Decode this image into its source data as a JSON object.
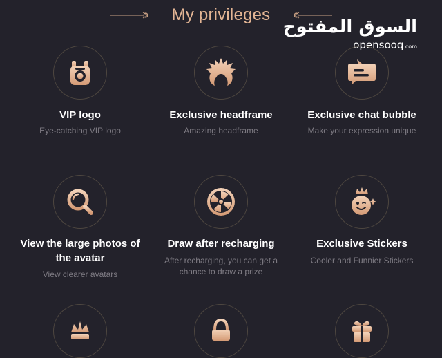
{
  "header": {
    "title": "My privileges"
  },
  "watermark": {
    "arabic": "السوق المفتوح",
    "latin": "opensooq",
    "domain": ".com"
  },
  "colors": {
    "background": "#23222b",
    "accent": "#e3b594",
    "ring": "#4e4740",
    "title_text": "#ffffff",
    "desc_text": "#7f7c84"
  },
  "privileges": [
    {
      "icon": "vip-logo-icon",
      "title": "VIP logo",
      "desc": "Eye-catching VIP logo"
    },
    {
      "icon": "headframe-icon",
      "title": "Exclusive headframe",
      "desc": "Amazing headframe"
    },
    {
      "icon": "chat-bubble-icon",
      "title": "Exclusive chat bubble",
      "desc": "Make your expression unique"
    },
    {
      "icon": "magnifier-icon",
      "title_line1": "View the large photos of",
      "title_line2": "the avatar",
      "desc": "View clearer avatars"
    },
    {
      "icon": "lucky-wheel-icon",
      "title": "Draw after recharging",
      "desc_line1": "After recharging, you can get a",
      "desc_line2": "chance to draw a prize"
    },
    {
      "icon": "sticker-icon",
      "title": "Exclusive Stickers",
      "desc": "Cooler and Funnier Stickers"
    },
    {
      "icon": "crown-badge-icon"
    },
    {
      "icon": "bag-icon"
    },
    {
      "icon": "gift-icon"
    }
  ]
}
